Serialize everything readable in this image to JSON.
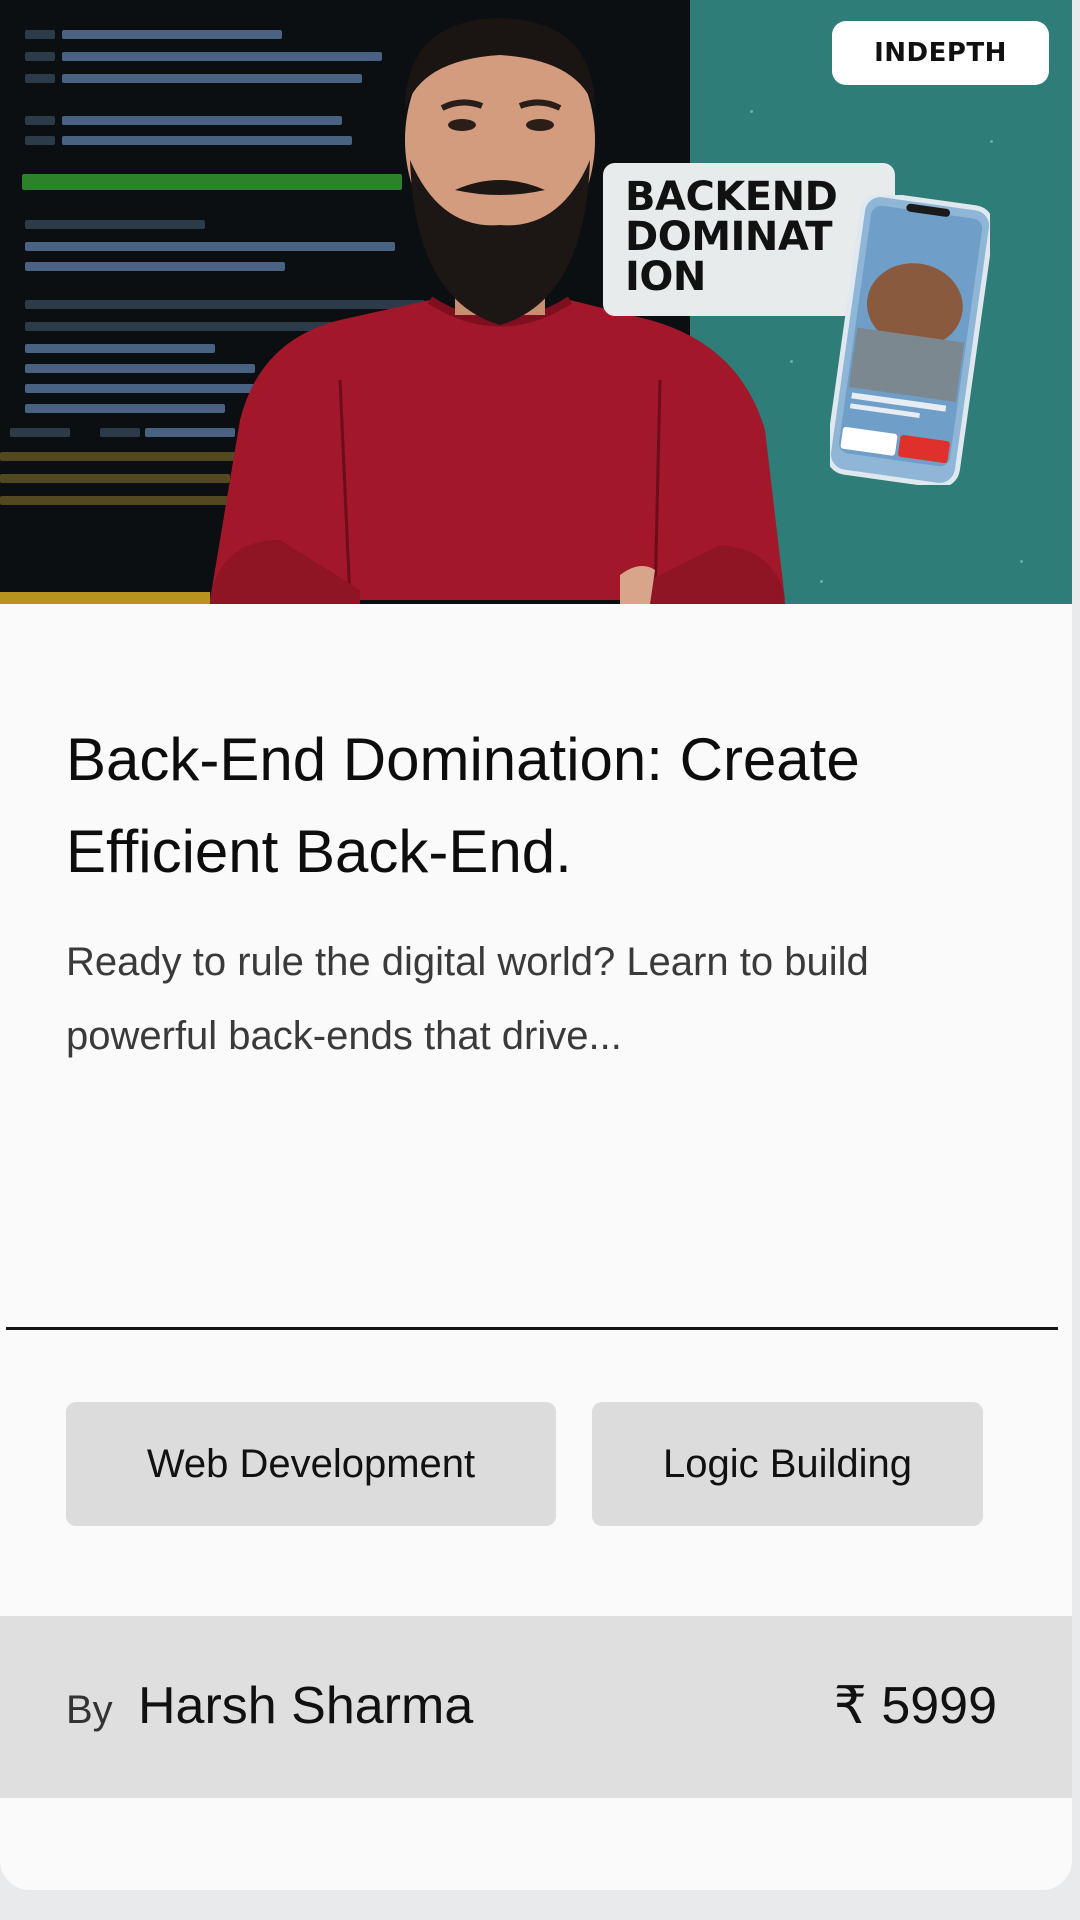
{
  "thumbnail": {
    "badge": "INDEPTH",
    "tag_lines": [
      "BACKEND",
      "DOMINAT",
      "ION"
    ]
  },
  "course": {
    "title": "Back-End Domination: Create Efficient Back-End.",
    "description": "Ready to rule the digital world? Learn to build powerful back-ends that drive...",
    "tags": [
      "Web Development",
      "Logic Building"
    ]
  },
  "footer": {
    "by_label": "By",
    "author": "Harsh Sharma",
    "price": "₹ 5999"
  },
  "colors": {
    "teal": "#2e7d78",
    "shirt": "#a3172a",
    "tag_bg": "#dcdcdc",
    "footer_bg": "#dfdfdf"
  }
}
